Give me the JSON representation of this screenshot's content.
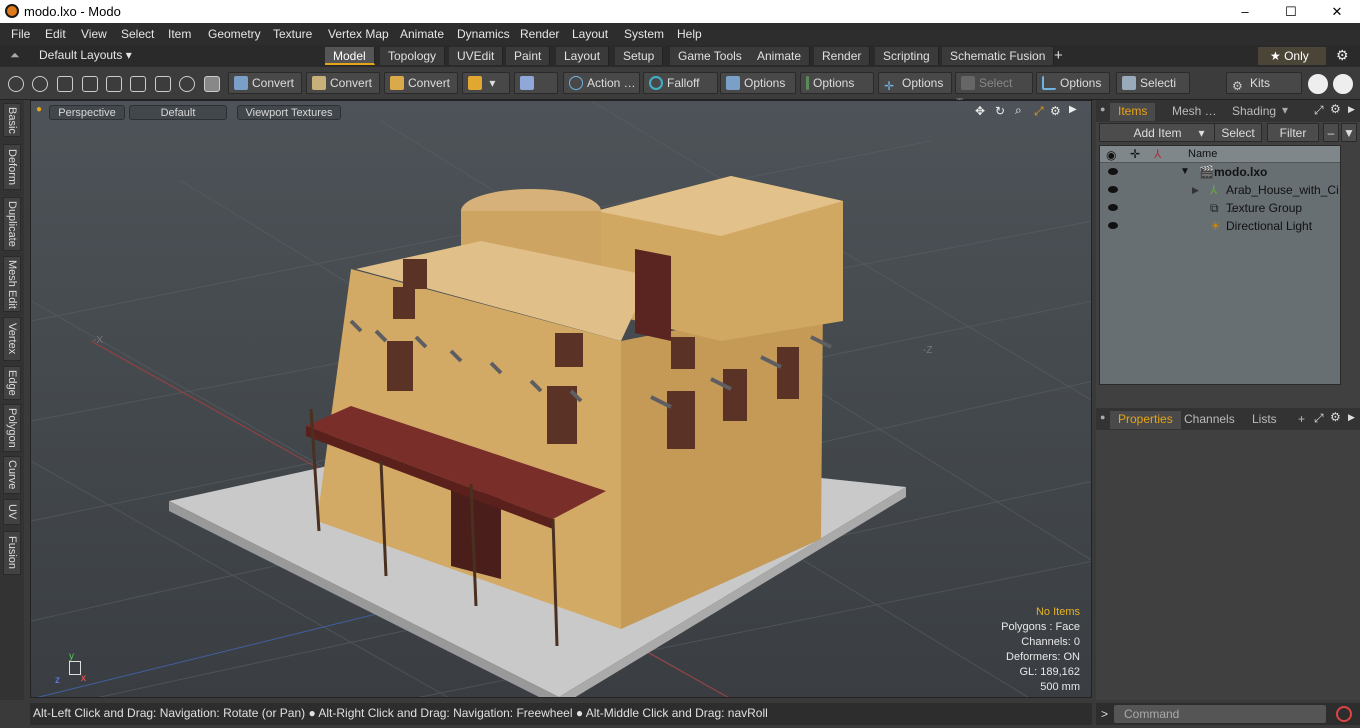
{
  "window": {
    "title": "modo.lxo - Modo",
    "minimize": "–",
    "maximize": "☐",
    "close": "✕"
  },
  "menu": [
    "File",
    "Edit",
    "View",
    "Select",
    "Item",
    "Geometry",
    "Texture",
    "Vertex Map",
    "Animate",
    "Dynamics",
    "Render",
    "Layout",
    "System",
    "Help"
  ],
  "layouts": {
    "label": "Default Layouts ▾"
  },
  "tabs": [
    "Model",
    "Topology",
    "UVEdit",
    "Paint",
    "Layout",
    "Setup",
    "Game Tools",
    "Animate",
    "Render",
    "Scripting",
    "Schematic Fusion",
    "+"
  ],
  "only": "★  Only",
  "toolbar": {
    "convert1": "Convert",
    "convert2": "Convert",
    "convert3": "Convert",
    "action": "Action …",
    "falloff": "Falloff",
    "options1": "Options",
    "options2": "Options",
    "options3": "Options",
    "select_t": "Select T…",
    "options4": "Options",
    "selecti": "Selecti …",
    "kits": "Kits"
  },
  "left_tabs": [
    "Basic",
    "Deform",
    "Duplicate",
    "Mesh Edit",
    "Vertex",
    "Edge",
    "Polygon",
    "Curve",
    "UV",
    "Fusion"
  ],
  "viewport": {
    "view": "Perspective",
    "shading": "Default",
    "textures": "Viewport Textures",
    "hud": {
      "no_items": "No Items",
      "polygons": "Polygons : Face",
      "channels": "Channels: 0",
      "deformers": "Deformers: ON",
      "gl": "GL: 189,162",
      "scale": "500 mm"
    },
    "axis_labels": {
      "x": "-X",
      "z": "-Z"
    }
  },
  "status": "Alt-Left Click and Drag: Navigation: Rotate (or Pan) ● Alt-Right Click and Drag: Navigation: Freewheel ● Alt-Middle Click and Drag: navRoll",
  "items_panel": {
    "tabs": [
      "Items",
      "Mesh …",
      "Shading"
    ],
    "add_item": "Add Item",
    "select": "Select",
    "filter": "Filter",
    "header": "Name",
    "rows": [
      {
        "label": "modo.lxo"
      },
      {
        "label": "Arab_House_with_Ci …"
      },
      {
        "label": "Texture Group"
      },
      {
        "label": "Directional Light"
      }
    ]
  },
  "properties_panel": {
    "tabs": [
      "Properties",
      "Channels",
      "Lists",
      "+"
    ]
  },
  "command": {
    "placeholder": "Command"
  },
  "colors": {
    "accent": "#e6a417",
    "viewport": "#464b50",
    "wall": "#d2aa66"
  }
}
